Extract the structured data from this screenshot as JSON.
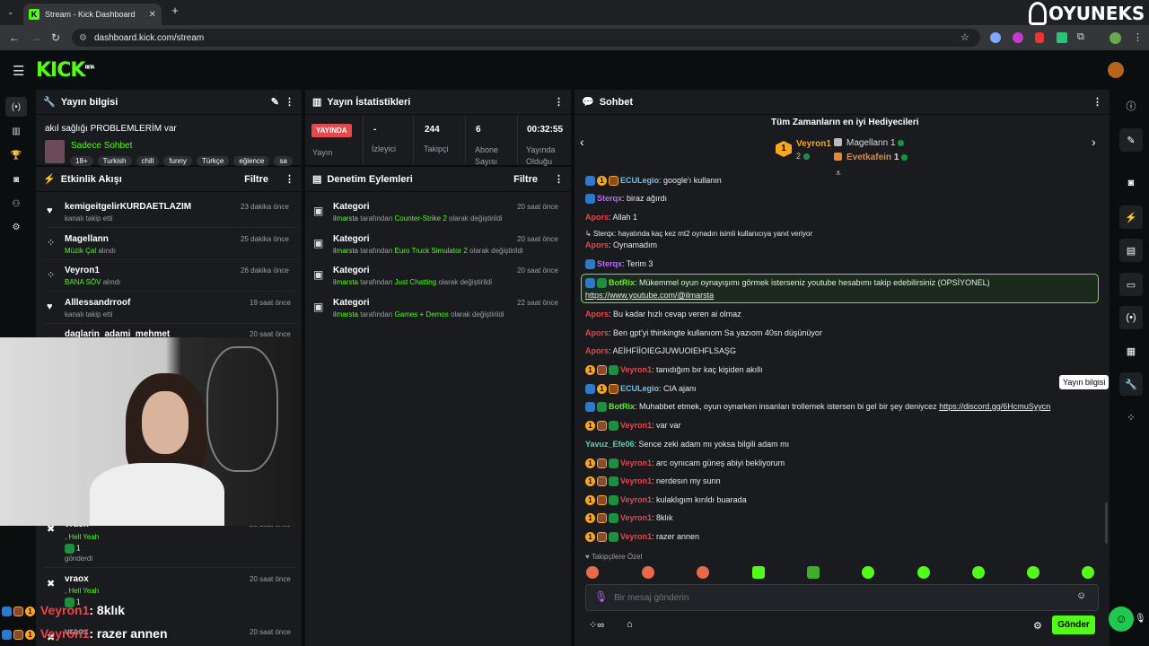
{
  "browser": {
    "tab_title": "Stream - Kick Dashboard",
    "url": "dashboard.kick.com/stream"
  },
  "overlay_logo": "OYUNEKS",
  "kick_logo": "KICK",
  "kick_beta": "BETA",
  "stream_info": {
    "title": "Yayın bilgisi",
    "stream_title": "akıl sağlığı PROBLEMLERİM var",
    "category": "Sadece Sohbet",
    "tags": [
      "18+",
      "Turkish",
      "chill",
      "funny",
      "Türkçe",
      "eğlence",
      "sa"
    ]
  },
  "stats": {
    "title": "Yayın İstatistikleri",
    "live_badge": "YAYINDA",
    "items": [
      {
        "value": "",
        "label": "Yayın"
      },
      {
        "value": "-",
        "label": "İzleyici"
      },
      {
        "value": "244",
        "label": "Takipçi"
      },
      {
        "value": "6",
        "label": "Abone Sayısı"
      },
      {
        "value": "00:32:55",
        "label": "Yayında Olduğu"
      }
    ]
  },
  "activity": {
    "title": "Etkinlik Akışı",
    "filter": "Filtre",
    "items": [
      {
        "user": "kemigeitgelirKURDAETLAZIM",
        "time": "23 dakika önce",
        "desc": "kanalı takip etti"
      },
      {
        "user": "Magellann",
        "time": "25 dakika önce",
        "desc": "Müzik Çal",
        "desc2": "alındı"
      },
      {
        "user": "Veyron1",
        "time": "26 dakika önce",
        "desc": "BANA SÖV",
        "desc2": "alındı"
      },
      {
        "user": "Alllessandrroof",
        "time": "19 saat önce",
        "desc": "kanalı takip etti"
      },
      {
        "user": "daglarin_adami_mehmet",
        "time": "20 saat önce",
        "desc": ""
      }
    ],
    "lower": [
      {
        "user": "vraox",
        "time": "20 saat önce",
        "line1": ", Hell Yeah",
        "count": "1",
        "line2": "gönderdi"
      },
      {
        "user": "vraox",
        "time": "20 saat önce",
        "line1": ", Hell Yeah",
        "count": "1",
        "line2": ""
      },
      {
        "user": "vraox",
        "time": "20 saat önce",
        "line1": "",
        "count": "",
        "line2": ""
      }
    ]
  },
  "moderation": {
    "title": "Denetim Eylemleri",
    "filter": "Filtre",
    "items": [
      {
        "label": "Kategori",
        "time": "20 saat önce",
        "user": "ilmarsta",
        "mid": "tarafından",
        "cat": "Counter-Strike 2",
        "end": "olarak değiştirildi"
      },
      {
        "label": "Kategori",
        "time": "20 saat önce",
        "user": "ilmarsta",
        "mid": "tarafından",
        "cat": "Euro Truck Simulator 2",
        "end": "olarak değiştirildi"
      },
      {
        "label": "Kategori",
        "time": "20 saat önce",
        "user": "ilmarsta",
        "mid": "tarafından",
        "cat": "Just Chatting",
        "end": "olarak değiştirildi"
      },
      {
        "label": "Kategori",
        "time": "22 saat önce",
        "user": "ilmarsta",
        "mid": "tarafından",
        "cat": "Games + Demos",
        "end": "olarak değiştirildi"
      }
    ]
  },
  "chat": {
    "title": "Sohbet",
    "gifters_title": "Tüm Zamanların en iyi Hediyecileri",
    "gifter1": "Veyron1",
    "gifter1_count": "2",
    "gifter2": "Magellann",
    "gifter2_count": "1",
    "gifter3": "Evetkafein",
    "gifter3_count": "1",
    "messages": [
      {
        "user": "ECULegio",
        "text": ": google'ı kullanın"
      },
      {
        "user": "Sterqx",
        "text": ": biraz ağırdı"
      },
      {
        "user": "Apors",
        "text": ": Allah 1"
      },
      {
        "reply": "Sterqx: hayatında kaç kez mt2 oynadın isimli kullanıcıya yanıt veriyor"
      },
      {
        "user": "Apors",
        "text": ": Oynamadım"
      },
      {
        "user": "Sterqx",
        "text": ": Terim 3"
      },
      {
        "user": "BotRix",
        "text": ": Mükemmel oyun oynayışımı görmek isterseniz youtube hesabımı takip edebilirsiniz (OPSİYONEL)",
        "link": "https://www.youtube.com/@ilmarsta"
      },
      {
        "user": "Apors",
        "text": ": Bu kadar hızlı cevap veren ai olmaz"
      },
      {
        "user": "Apors",
        "text": ": Ben gpt'yi thinkingte kullanıom Sa yazıom 40sn düşünüyor"
      },
      {
        "user": "Apors",
        "text": ": AEİHFİİOIEGJUWUOIEHFLSAŞG"
      },
      {
        "user": "Veyron1",
        "text": ": tanıdığım bır kaç kişiden akıllı"
      },
      {
        "user": "ECULegio",
        "text": ": CIA ajanı"
      },
      {
        "user": "BotRix",
        "text": ": Muhabbet etmek, oyun oynarken insanları trollemek istersen bi gel bir şey deniycez",
        "link": "https://discord.gg/6HcmuSyycn"
      },
      {
        "user": "Veyron1",
        "text": ": var var"
      },
      {
        "user": "Yavuz_Efe06",
        "text": ": Sence zeki adam mı yoksa bilgili adam mı"
      },
      {
        "user": "Veyron1",
        "text": ": arc oynıcam güneş abiyi bekliyorum"
      },
      {
        "user": "Veyron1",
        "text": ": nerdesın my sunn"
      },
      {
        "user": "Veyron1",
        "text": ": kulaklıgım kırıldı buarada"
      },
      {
        "user": "Veyron1",
        "text": ": 8klık"
      },
      {
        "user": "Veyron1",
        "text": ": razer annen"
      }
    ],
    "followers_only": "Takipçilere Özel",
    "placeholder": "Bir mesaj gönderin",
    "send": "Gönder"
  },
  "tooltip": "Yayın bilgisi",
  "overlay_chat": [
    {
      "user": "Veyron1",
      "text": ": 8klık"
    },
    {
      "user": "Veyron1",
      "text": ": razer annen"
    }
  ],
  "colors": {
    "kick_green": "#53fc18",
    "panel": "#191b1f"
  }
}
